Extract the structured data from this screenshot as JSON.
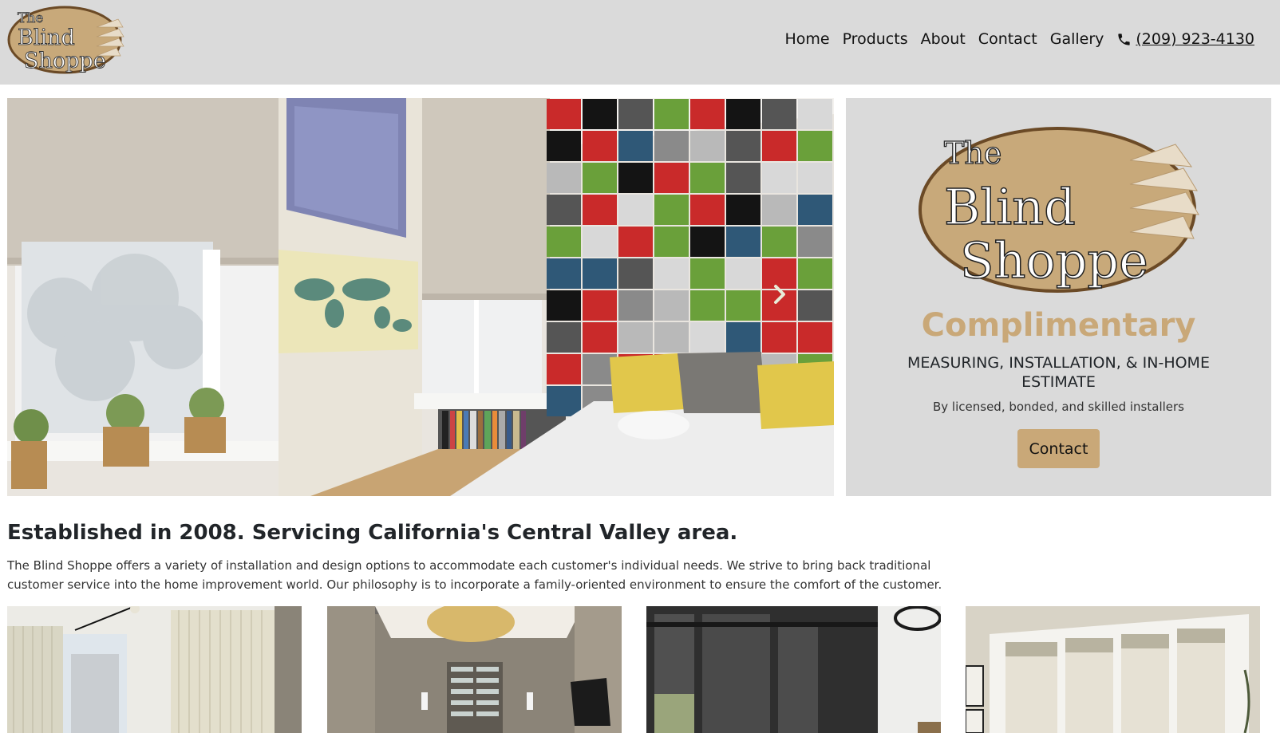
{
  "header": {
    "logo_alt": "The Blind Shoppe",
    "logo_lines": [
      "The",
      "Blind",
      "Shoppe"
    ],
    "nav": [
      {
        "label": "Home"
      },
      {
        "label": "Products"
      },
      {
        "label": "About"
      },
      {
        "label": "Contact"
      },
      {
        "label": "Gallery"
      }
    ],
    "phone": "(209) 923-4130",
    "phone_icon": "phone-icon"
  },
  "hero": {
    "image_description": "Bedroom with roller shades and colorful wall panels",
    "next_icon": "chevron-right-icon"
  },
  "promo": {
    "logo_lines": [
      "The",
      "Blind",
      "Shoppe"
    ],
    "title": "Complimentary",
    "subtitle": "MEASURING, INSTALLATION, & IN-HOME ESTIMATE",
    "note": "By licensed, bonded, and skilled installers",
    "button_label": "Contact"
  },
  "about": {
    "title": "Established in 2008. Servicing California's Central Valley area.",
    "text": "The Blind Shoppe offers a variety of installation and design options to accommodate each customer's individual needs. We strive to bring back traditional customer service into the home improvement world. Our philosophy is to incorporate a family-oriented environment to ensure the comfort of the customer."
  },
  "gallery": [
    {
      "description": "Living room with vertical blinds"
    },
    {
      "description": "Hallway with zebra shades and chandelier"
    },
    {
      "description": "Room with dark roller shades"
    },
    {
      "description": "Room with light roman shades"
    }
  ],
  "colors": {
    "accent": "#c9a878",
    "header_bg": "#dadada",
    "logo_oval": "#c8a97a",
    "logo_border": "#6b4a26"
  }
}
